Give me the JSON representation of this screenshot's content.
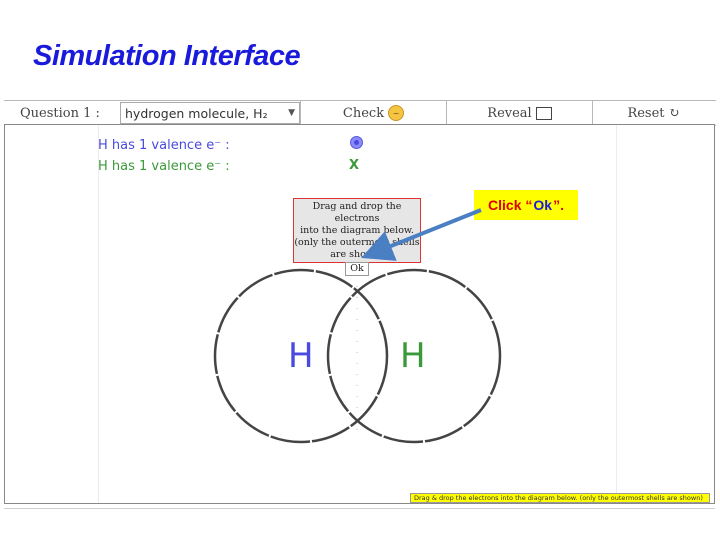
{
  "slide": {
    "title": "Simulation Interface"
  },
  "toolbar": {
    "question_label": "Question 1 :",
    "question_select": "hydrogen molecule, H₂",
    "check_label": "Check",
    "reveal_label": "Reveal",
    "reset_label": "Reset ↻",
    "check_icon": "confused-face-icon",
    "reveal_icon": "empty-box-icon"
  },
  "workspace": {
    "valence_lines": [
      "H has 1 valence e⁻ :",
      "H has 1 valence e⁻ :"
    ],
    "x_mark": "X",
    "instruction": {
      "line1": "Drag and drop the electrons",
      "line2": "into the diagram below.",
      "line3": "(only the outermost shells",
      "line4": "are shown)",
      "ok_label": "Ok"
    },
    "atoms": [
      "H",
      "H"
    ],
    "status": "Drag & drop the electrons into the diagram below. (only the outermost shells are shown)"
  },
  "callout": {
    "prefix": "Click “",
    "keyword": "Ok",
    "suffix": "”."
  },
  "colors": {
    "atom1": "#4a4ae0",
    "atom2": "#3a9a3a",
    "title": "#1a1adb",
    "callout_bg": "#ffff00"
  }
}
